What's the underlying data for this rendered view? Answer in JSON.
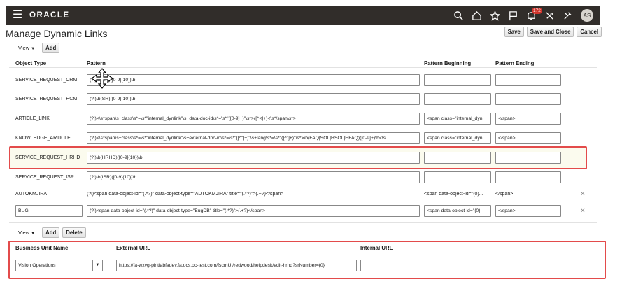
{
  "app": {
    "title": "ORACLE",
    "notification_count": "172",
    "avatar_initials": "AS"
  },
  "page": {
    "title": "Manage Dynamic Links"
  },
  "actions": {
    "save": "Save",
    "save_close": "Save and Close",
    "cancel": "Cancel"
  },
  "toolbar1": {
    "view": "View",
    "add": "Add"
  },
  "links_table": {
    "headers": {
      "object_type": "Object Type",
      "pattern": "Pattern",
      "pattern_beginning": "Pattern Beginning",
      "pattern_ending": "Pattern Ending"
    },
    "rows": [
      {
        "object_type": "SERVICE_REQUEST_CRM",
        "pattern": "(?i)\\b(SR)([0-9]{10})\\b",
        "beginning": "",
        "ending": ""
      },
      {
        "object_type": "SERVICE_REQUEST_HCM",
        "pattern": "(?i)\\b(SR)([0-9]{10})\\b",
        "beginning": "",
        "ending": ""
      },
      {
        "object_type": "ARTICLE_LINK",
        "pattern": "(?i)<\\s*span\\s+class\\s*=\\s*\"internal_dynlink\"\\s+data-doc-id\\s*=\\s*\"([0-9]+)\"\\s*>([^<]+)<\\s*/span\\s*>",
        "beginning": "<span class=\"internal_dyn",
        "ending": "</span>"
      },
      {
        "object_type": "KNOWLEDGE_ARTICLE",
        "pattern": "(?i)<\\s*span\\s+class\\s*=\\s*\"internal_dynlink\"\\s+external-doc-id\\s*=\\s*\"([^\"]+)\"\\s+lang\\s*=\\s*\"([^\"]+)\"\\s*>\\b(FAQ|SOL|HSOL|HFAQ)([0-9]+)\\b<\\s",
        "beginning": "<span class=\"internal_dyn",
        "ending": "</span>"
      },
      {
        "object_type": "SERVICE_REQUEST_HRHD",
        "pattern": "(?i)\\b(HRHD)([0-9]{10})\\b",
        "beginning": "",
        "ending": ""
      },
      {
        "object_type": "SERVICE_REQUEST_ISR",
        "pattern": "(?i)\\b(ISR)([0-9]{10})\\b",
        "beginning": "",
        "ending": ""
      },
      {
        "object_type": "AUTOKMJIRA",
        "pattern": "(?i)<span data-object-id=\"(.*?)\" data-object-type=\"AUTOKMJIRA\" title=\"(.*?)\">(.+?)</span>",
        "beginning": "<span data-object-id=\"(0)...",
        "ending": "</span>"
      },
      {
        "object_type": "BUG",
        "pattern": "(?i)<span data-object-id=\"(.*?)\" data-object-type=\"BugDB\" title=\"(.*?)\">(.+?)</span>",
        "beginning": "<span data-object-id=\"{0}",
        "ending": "</span>"
      }
    ]
  },
  "toolbar2": {
    "view": "View",
    "add": "Add",
    "delete": "Delete"
  },
  "bu_table": {
    "headers": {
      "business_unit": "Business Unit Name",
      "external_url": "External URL",
      "internal_url": "Internal URL"
    },
    "row": {
      "business_unit": "Vision Operations",
      "external_url": "https://fa-wxvg-pintlabfadev.fa.ocs.oc-test.com/fscmUI/redwood/helpdesk/edit-hrhd?srNumber={0}",
      "internal_url": ""
    }
  },
  "colors": {
    "topbar": "#312d2a",
    "highlight_border": "#e34b4b",
    "badge": "#d0342c"
  }
}
